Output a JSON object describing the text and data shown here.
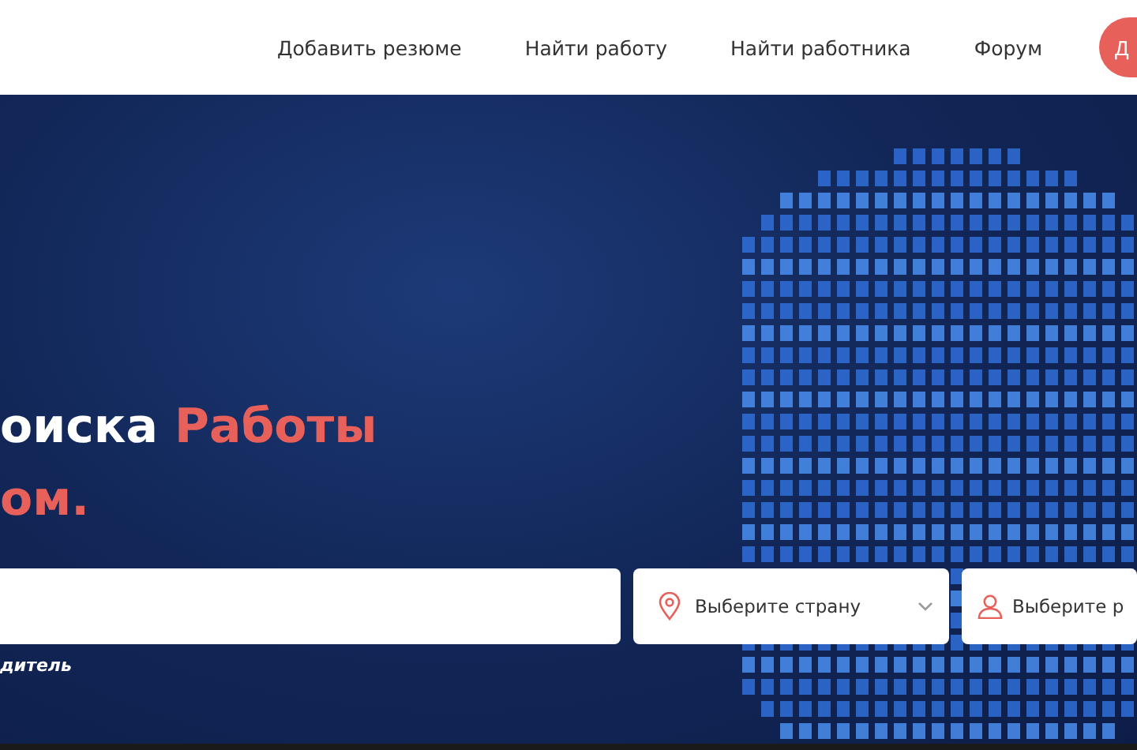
{
  "nav": {
    "items": [
      "Добавить резюме",
      "Найти работу",
      "Найти работника",
      "Форум"
    ],
    "button": "Д"
  },
  "hero": {
    "headline": [
      [
        {
          "text": "оиска ",
          "accent": false
        },
        {
          "text": "Работы",
          "accent": true
        }
      ],
      [
        {
          "text": "ом.",
          "accent": true
        }
      ]
    ],
    "country_select": {
      "placeholder": "Выберите страну"
    },
    "role_select": {
      "placeholder": "Выберите р"
    },
    "caption": "дитель"
  }
}
